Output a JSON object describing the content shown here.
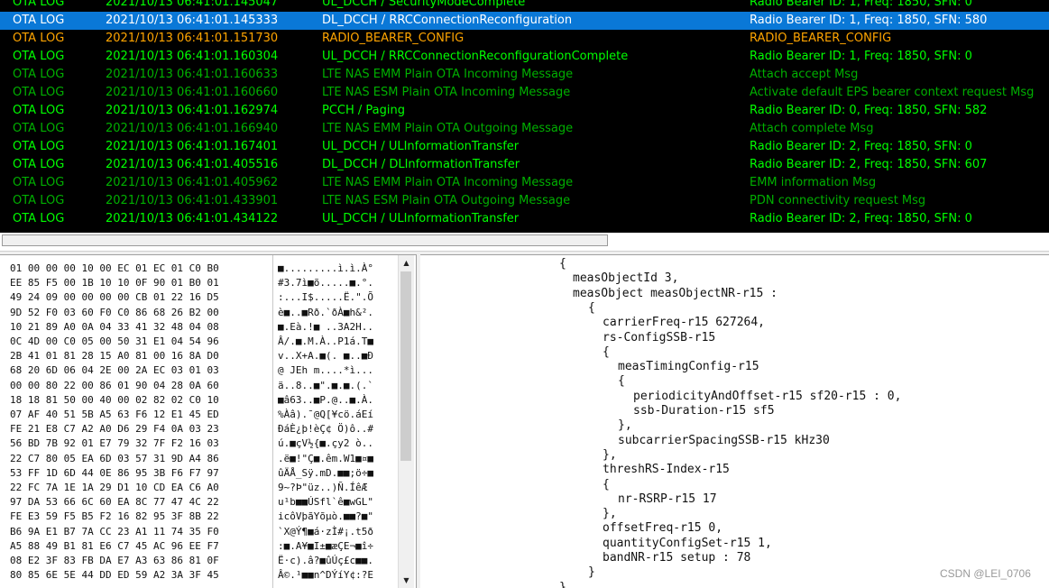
{
  "log": {
    "rows": [
      {
        "type": "OTA LOG",
        "time": "2021/10/13 06:41:01.145047",
        "msg": "UL_DCCH / SecurityModeComplete",
        "info": "Radio Bearer ID: 1, Freq: 1850, SFN: 0",
        "color": "#00ff00",
        "selected": false
      },
      {
        "type": "OTA LOG",
        "time": "2021/10/13 06:41:01.145333",
        "msg": "DL_DCCH / RRCConnectionReconfiguration",
        "info": "Radio Bearer ID: 1, Freq: 1850, SFN: 580",
        "color": "#ffffff",
        "selected": true
      },
      {
        "type": "OTA LOG",
        "time": "2021/10/13 06:41:01.151730",
        "msg": "RADIO_BEARER_CONFIG",
        "info": "RADIO_BEARER_CONFIG",
        "color": "#ffa500",
        "selected": false
      },
      {
        "type": "OTA LOG",
        "time": "2021/10/13 06:41:01.160304",
        "msg": "UL_DCCH / RRCConnectionReconfigurationComplete",
        "info": "Radio Bearer ID: 1, Freq: 1850, SFN: 0",
        "color": "#00ff00",
        "selected": false
      },
      {
        "type": "OTA LOG",
        "time": "2021/10/13 06:41:01.160633",
        "msg": "LTE NAS EMM Plain OTA Incoming Message",
        "info": "Attach accept Msg",
        "color": "#00b000",
        "selected": false
      },
      {
        "type": "OTA LOG",
        "time": "2021/10/13 06:41:01.160660",
        "msg": "LTE NAS ESM Plain OTA Incoming Message",
        "info": "Activate default EPS bearer context request Msg",
        "color": "#00b000",
        "selected": false
      },
      {
        "type": "OTA LOG",
        "time": "2021/10/13 06:41:01.162974",
        "msg": "PCCH / Paging",
        "info": "Radio Bearer ID: 0, Freq: 1850, SFN: 582",
        "color": "#00ff00",
        "selected": false
      },
      {
        "type": "OTA LOG",
        "time": "2021/10/13 06:41:01.166940",
        "msg": "LTE NAS EMM Plain OTA Outgoing Message",
        "info": "Attach complete Msg",
        "color": "#00b000",
        "selected": false
      },
      {
        "type": "OTA LOG",
        "time": "2021/10/13 06:41:01.167401",
        "msg": "UL_DCCH / ULInformationTransfer",
        "info": "Radio Bearer ID: 2, Freq: 1850, SFN: 0",
        "color": "#00ff00",
        "selected": false
      },
      {
        "type": "OTA LOG",
        "time": "2021/10/13 06:41:01.405516",
        "msg": "DL_DCCH / DLInformationTransfer",
        "info": "Radio Bearer ID: 2, Freq: 1850, SFN: 607",
        "color": "#00ff00",
        "selected": false
      },
      {
        "type": "OTA LOG",
        "time": "2021/10/13 06:41:01.405962",
        "msg": "LTE NAS EMM Plain OTA Incoming Message",
        "info": "EMM information Msg",
        "color": "#00b000",
        "selected": false
      },
      {
        "type": "OTA LOG",
        "time": "2021/10/13 06:41:01.433901",
        "msg": "LTE NAS ESM Plain OTA Outgoing Message",
        "info": "PDN connectivity request Msg",
        "color": "#00b000",
        "selected": false
      },
      {
        "type": "OTA LOG",
        "time": "2021/10/13 06:41:01.434122",
        "msg": "UL_DCCH / ULInformationTransfer",
        "info": "Radio Bearer ID: 2, Freq: 1850, SFN: 0",
        "color": "#00ff00",
        "selected": false
      }
    ]
  },
  "hex": {
    "lines": [
      {
        "hex": "01 00 00 00 10 00 EC 01 EC 01 C0 B0",
        "ascii": "■.........ì.ì.À°"
      },
      {
        "hex": "EE 85 F5 00 1B 10 10 0F 90 01 B0 01",
        "ascii": "#3.7ì■õ.....■.°."
      },
      {
        "hex": "49 24 09 00 00 00 00 CB 01 22 16 D5",
        "ascii": ":...I$.....Ë.\".Õ"
      },
      {
        "hex": "9D 52 F0 03 60 F0 C0 86 68 26 B2 00",
        "ascii": "è■..■Rð.`ðÀ■h&²."
      },
      {
        "hex": "10 21 89 A0 0A 04 33 41 32 48 04 08",
        "ascii": "■.Eà.!■ ..3A2H.."
      },
      {
        "hex": "0C 4D 00 C0 05 00 50 31 E1 04 54 96",
        "ascii": "Â/.■.M.À..P1á.T■"
      },
      {
        "hex": "2B 41 01 81 28 15 A0 81 00 16 8A D0",
        "ascii": "v..X+A.■(. ■..■Ð"
      },
      {
        "hex": "68 20 6D 06 04 2E 00 2A EC 03 01 03",
        "ascii": "@ JEh m....*ì..."
      },
      {
        "hex": "00 00 80 22 00 86 01 90 04 28 0A 60",
        "ascii": "ä..8..■\".■.■.(.`"
      },
      {
        "hex": "18 18 81 50 00 40 00 02 82 02 C0 10",
        "ascii": "■â63..■P.@..■.À."
      },
      {
        "hex": "07 AF 40 51 5B A5 63 F6 12 E1 45 ED",
        "ascii": "%Àâ).¯@Q[¥cö.áEí"
      },
      {
        "hex": "FE 21 E8 C7 A2 A0 D6 29 F4 0A 03 23",
        "ascii": "ÐáÈ¿þ!èÇ¢ Ö)ô..#"
      },
      {
        "hex": "56 BD 7B 92 01 E7 79 32 7F F2 16 03",
        "ascii": "ú.■çV½{■.çy2 ò.."
      },
      {
        "hex": "22 C7 80 05 EA 6D 03 57 31 9D A4 86",
        "ascii": ".ë■!\"Ç■.êm.W1■¤■"
      },
      {
        "hex": "53 FF 1D 6D 44 0E 86 95 3B F6 F7 97",
        "ascii": "ûÄÅ_Sÿ.mD.■■;ö÷■"
      },
      {
        "hex": "22 FC 7A 1E 1A 29 D1 10 CD EA C6 A0",
        "ascii": "9~?Þ\"üz..)Ñ.ÍêÆ "
      },
      {
        "hex": "97 DA 53 66 6C 60 EA 8C 77 47 4C 22",
        "ascii": "u¹b■■ÚSfl`ê■wGL\""
      },
      {
        "hex": "FE E3 59 F5 B5 F2 16 82 95 3F 8B 22",
        "ascii": "icôVþãYõµò.■■?■\""
      },
      {
        "hex": "B6 9A E1 B7 7A CC 23 A1 11 74 35 F0",
        "ascii": "`X@Ý¶■á·zÌ#¡.t5ð"
      },
      {
        "hex": "A5 88 49 B1 81 E6 C7 45 AC 96 EE F7",
        "ascii": ":■.A¥■I±■æÇE¬■î÷"
      },
      {
        "hex": "08 E2 3F 83 FB DA E7 A3 63 86 81 0F",
        "ascii": "Ë·c).â?■ûÚç£c■■."
      },
      {
        "hex": "80 85 6E 5E 44 DD ED 59 A2 3A 3F 45",
        "ascii": "Â©.¹■■n^DÝíY¢:?E"
      }
    ]
  },
  "detail": {
    "lines": [
      {
        "text": "{",
        "indent": 0
      },
      {
        "text": "measObjectId 3,",
        "indent": 1
      },
      {
        "text": "measObject measObjectNR-r15 :",
        "indent": 1
      },
      {
        "text": "{",
        "indent": 2
      },
      {
        "text": "carrierFreq-r15 627264,",
        "indent": 3
      },
      {
        "text": "rs-ConfigSSB-r15",
        "indent": 3
      },
      {
        "text": "{",
        "indent": 3
      },
      {
        "text": "measTimingConfig-r15",
        "indent": 4
      },
      {
        "text": "{",
        "indent": 4
      },
      {
        "text": "periodicityAndOffset-r15 sf20-r15 : 0,",
        "indent": 5
      },
      {
        "text": "ssb-Duration-r15 sf5",
        "indent": 5
      },
      {
        "text": "},",
        "indent": 4
      },
      {
        "text": "subcarrierSpacingSSB-r15 kHz30",
        "indent": 4
      },
      {
        "text": "},",
        "indent": 3
      },
      {
        "text": "threshRS-Index-r15",
        "indent": 3
      },
      {
        "text": "{",
        "indent": 3
      },
      {
        "text": "nr-RSRP-r15 17",
        "indent": 4
      },
      {
        "text": "},",
        "indent": 3
      },
      {
        "text": "offsetFreq-r15 0,",
        "indent": 3
      },
      {
        "text": "quantityConfigSet-r15 1,",
        "indent": 3
      },
      {
        "text": "bandNR-r15 setup : 78",
        "indent": 3
      },
      {
        "text": "}",
        "indent": 2
      },
      {
        "text": "}",
        "indent": 0
      }
    ]
  },
  "scroll": {
    "up_icon": "▲",
    "down_icon": "▼"
  },
  "watermark": "CSDN @LEI_0706"
}
